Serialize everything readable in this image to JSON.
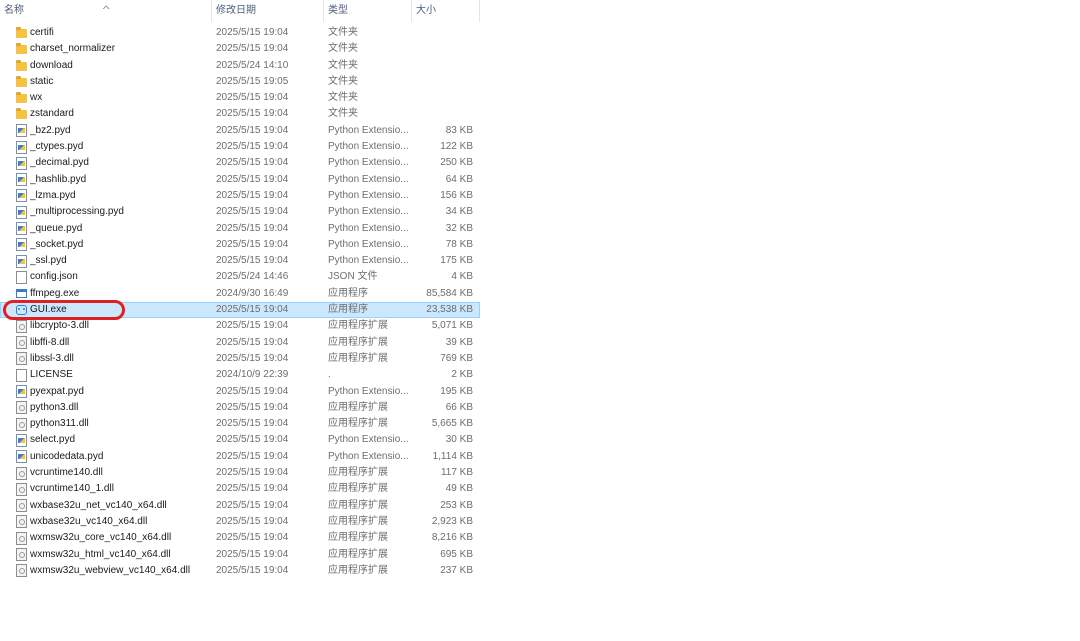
{
  "columns": {
    "name": "名称",
    "date": "修改日期",
    "type": "类型",
    "size": "大小",
    "sort_indicator": "^"
  },
  "files": [
    {
      "name": "certifi",
      "date": "2025/5/15 19:04",
      "type": "文件夹",
      "size": "",
      "icon": "folder-icon"
    },
    {
      "name": "charset_normalizer",
      "date": "2025/5/15 19:04",
      "type": "文件夹",
      "size": "",
      "icon": "folder-icon"
    },
    {
      "name": "download",
      "date": "2025/5/24 14:10",
      "type": "文件夹",
      "size": "",
      "icon": "folder-icon"
    },
    {
      "name": "static",
      "date": "2025/5/15 19:05",
      "type": "文件夹",
      "size": "",
      "icon": "folder-icon"
    },
    {
      "name": "wx",
      "date": "2025/5/15 19:04",
      "type": "文件夹",
      "size": "",
      "icon": "folder-icon"
    },
    {
      "name": "zstandard",
      "date": "2025/5/15 19:04",
      "type": "文件夹",
      "size": "",
      "icon": "folder-icon"
    },
    {
      "name": "_bz2.pyd",
      "date": "2025/5/15 19:04",
      "type": "Python Extensio...",
      "size": "83 KB",
      "icon": "python-extension-icon"
    },
    {
      "name": "_ctypes.pyd",
      "date": "2025/5/15 19:04",
      "type": "Python Extensio...",
      "size": "122 KB",
      "icon": "python-extension-icon"
    },
    {
      "name": "_decimal.pyd",
      "date": "2025/5/15 19:04",
      "type": "Python Extensio...",
      "size": "250 KB",
      "icon": "python-extension-icon"
    },
    {
      "name": "_hashlib.pyd",
      "date": "2025/5/15 19:04",
      "type": "Python Extensio...",
      "size": "64 KB",
      "icon": "python-extension-icon"
    },
    {
      "name": "_lzma.pyd",
      "date": "2025/5/15 19:04",
      "type": "Python Extensio...",
      "size": "156 KB",
      "icon": "python-extension-icon"
    },
    {
      "name": "_multiprocessing.pyd",
      "date": "2025/5/15 19:04",
      "type": "Python Extensio...",
      "size": "34 KB",
      "icon": "python-extension-icon"
    },
    {
      "name": "_queue.pyd",
      "date": "2025/5/15 19:04",
      "type": "Python Extensio...",
      "size": "32 KB",
      "icon": "python-extension-icon"
    },
    {
      "name": "_socket.pyd",
      "date": "2025/5/15 19:04",
      "type": "Python Extensio...",
      "size": "78 KB",
      "icon": "python-extension-icon"
    },
    {
      "name": "_ssl.pyd",
      "date": "2025/5/15 19:04",
      "type": "Python Extensio...",
      "size": "175 KB",
      "icon": "python-extension-icon"
    },
    {
      "name": "config.json",
      "date": "2025/5/24 14:46",
      "type": "JSON 文件",
      "size": "4 KB",
      "icon": "file-icon"
    },
    {
      "name": "ffmpeg.exe",
      "date": "2024/9/30 16:49",
      "type": "应用程序",
      "size": "85,584 KB",
      "icon": "exe-icon"
    },
    {
      "name": "GUI.exe",
      "date": "2025/5/15 19:04",
      "type": "应用程序",
      "size": "23,538 KB",
      "icon": "gui-app-icon",
      "selected": true
    },
    {
      "name": "libcrypto-3.dll",
      "date": "2025/5/15 19:04",
      "type": "应用程序扩展",
      "size": "5,071 KB",
      "icon": "dll-icon"
    },
    {
      "name": "libffi-8.dll",
      "date": "2025/5/15 19:04",
      "type": "应用程序扩展",
      "size": "39 KB",
      "icon": "dll-icon"
    },
    {
      "name": "libssl-3.dll",
      "date": "2025/5/15 19:04",
      "type": "应用程序扩展",
      "size": "769 KB",
      "icon": "dll-icon"
    },
    {
      "name": "LICENSE",
      "date": "2024/10/9 22:39",
      "type": ".",
      "size": "2 KB",
      "icon": "file-icon"
    },
    {
      "name": "pyexpat.pyd",
      "date": "2025/5/15 19:04",
      "type": "Python Extensio...",
      "size": "195 KB",
      "icon": "python-extension-icon"
    },
    {
      "name": "python3.dll",
      "date": "2025/5/15 19:04",
      "type": "应用程序扩展",
      "size": "66 KB",
      "icon": "dll-icon"
    },
    {
      "name": "python311.dll",
      "date": "2025/5/15 19:04",
      "type": "应用程序扩展",
      "size": "5,665 KB",
      "icon": "dll-icon"
    },
    {
      "name": "select.pyd",
      "date": "2025/5/15 19:04",
      "type": "Python Extensio...",
      "size": "30 KB",
      "icon": "python-extension-icon"
    },
    {
      "name": "unicodedata.pyd",
      "date": "2025/5/15 19:04",
      "type": "Python Extensio...",
      "size": "1,114 KB",
      "icon": "python-extension-icon"
    },
    {
      "name": "vcruntime140.dll",
      "date": "2025/5/15 19:04",
      "type": "应用程序扩展",
      "size": "117 KB",
      "icon": "dll-icon"
    },
    {
      "name": "vcruntime140_1.dll",
      "date": "2025/5/15 19:04",
      "type": "应用程序扩展",
      "size": "49 KB",
      "icon": "dll-icon"
    },
    {
      "name": "wxbase32u_net_vc140_x64.dll",
      "date": "2025/5/15 19:04",
      "type": "应用程序扩展",
      "size": "253 KB",
      "icon": "dll-icon"
    },
    {
      "name": "wxbase32u_vc140_x64.dll",
      "date": "2025/5/15 19:04",
      "type": "应用程序扩展",
      "size": "2,923 KB",
      "icon": "dll-icon"
    },
    {
      "name": "wxmsw32u_core_vc140_x64.dll",
      "date": "2025/5/15 19:04",
      "type": "应用程序扩展",
      "size": "8,216 KB",
      "icon": "dll-icon"
    },
    {
      "name": "wxmsw32u_html_vc140_x64.dll",
      "date": "2025/5/15 19:04",
      "type": "应用程序扩展",
      "size": "695 KB",
      "icon": "dll-icon"
    },
    {
      "name": "wxmsw32u_webview_vc140_x64.dll",
      "date": "2025/5/15 19:04",
      "type": "应用程序扩展",
      "size": "237 KB",
      "icon": "dll-icon"
    }
  ],
  "colors": {
    "selected_bg": "#cce8ff",
    "annotation_ring": "#e02020"
  }
}
